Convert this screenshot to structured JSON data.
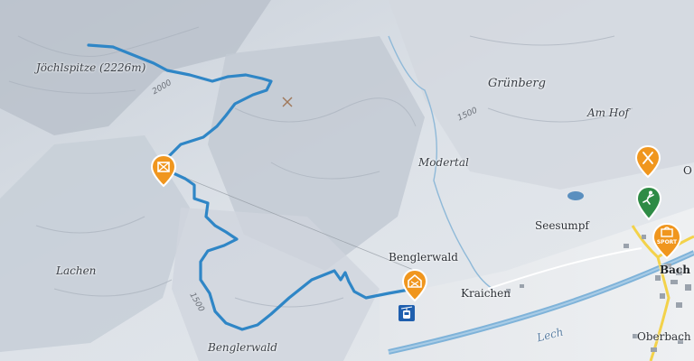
{
  "map": {
    "places": {
      "joechlspitze": "Jöchlspitze (2226m)",
      "gruenberg": "Grünberg",
      "am_hof": "Am Hof",
      "modertal": "Modertal",
      "seesumpf": "Seesumpf",
      "benglerwald_top": "Benglerwald",
      "kraichen": "Kraichen",
      "bach": "Bach",
      "oberbach": "Oberbach",
      "lachen": "Lachen",
      "benglerwald_bottom": "Benglerwald",
      "river_lech": "Lech",
      "edge_o": "O"
    },
    "contours": {
      "c2000": "2000",
      "c1500_a": "1500",
      "c1500_b": "1500"
    },
    "pois": {
      "sport_label": "SPORT"
    },
    "colors": {
      "route": "#2f86c6",
      "poi_orange": "#f0961e",
      "poi_green": "#2e8b45",
      "poi_blue": "#1f5fae",
      "road_yellow": "#f3d24a",
      "river": "#7fb3d9"
    }
  }
}
